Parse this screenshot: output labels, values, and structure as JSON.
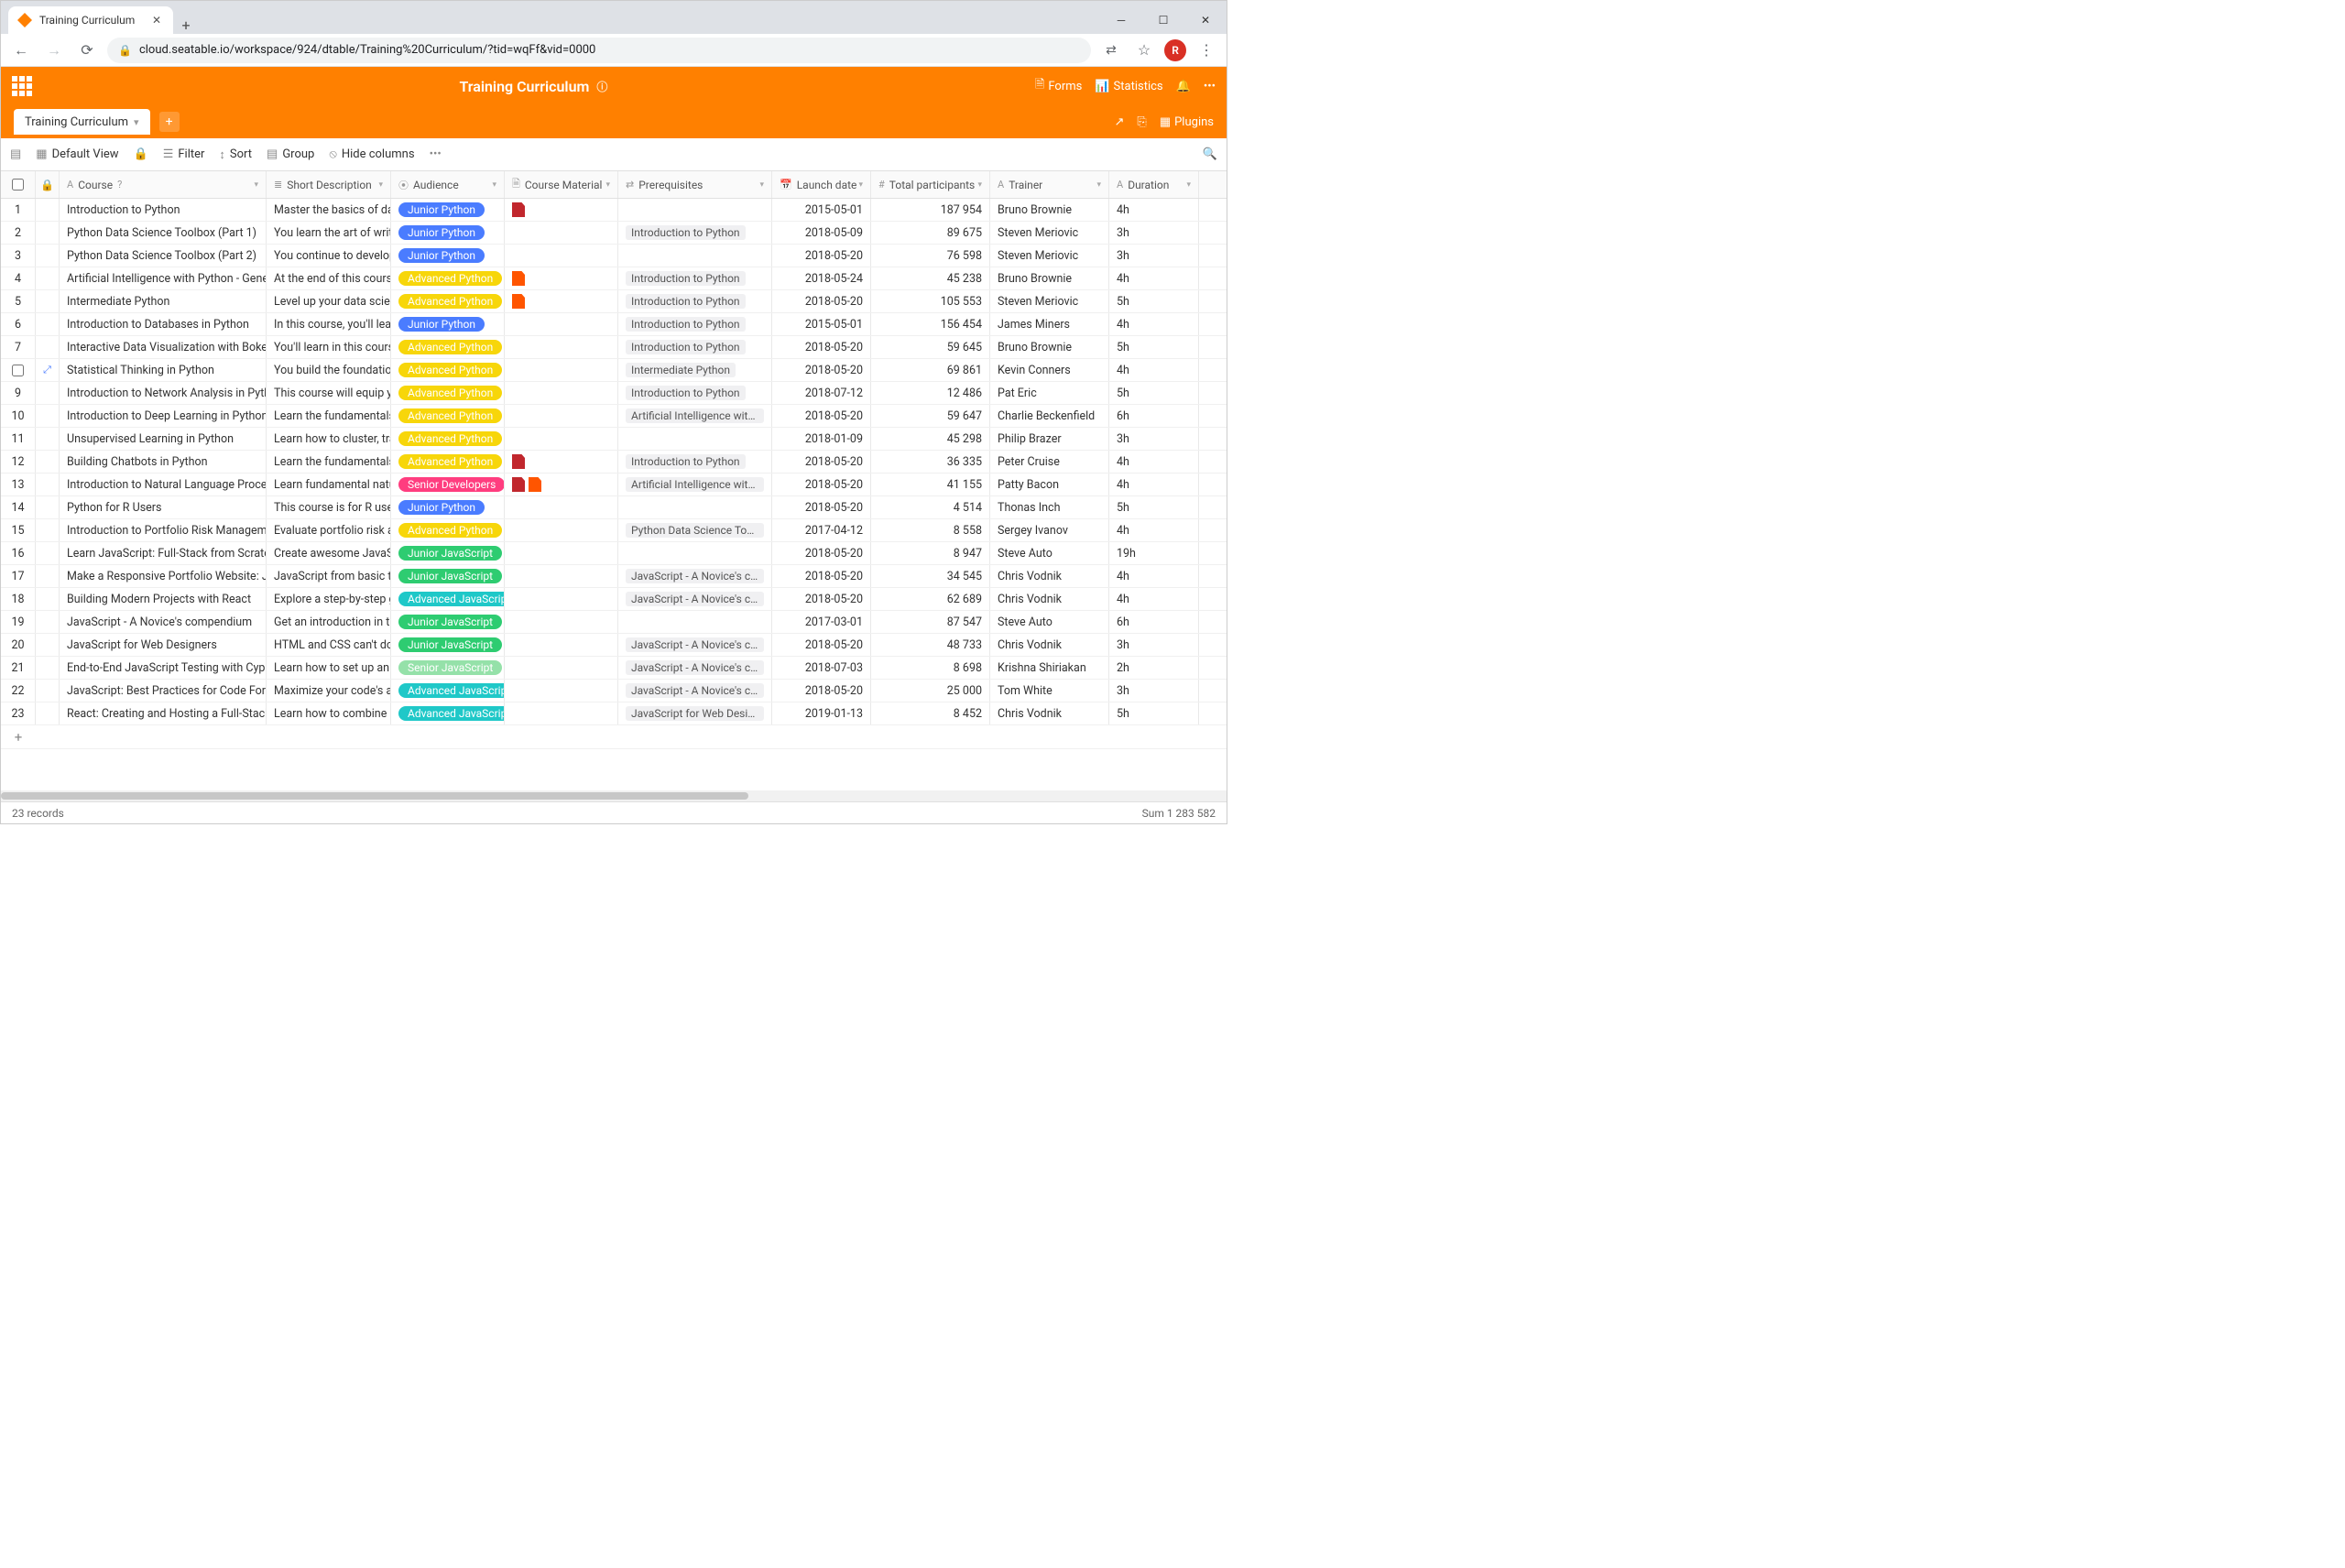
{
  "browser": {
    "tab_title": "Training Curriculum",
    "url_display": "cloud.seatable.io/workspace/924/dtable/Training%20Curriculum/?tid=wqFf&vid=0000",
    "avatar_letter": "R"
  },
  "header": {
    "title": "Training Curriculum",
    "forms": "Forms",
    "statistics": "Statistics",
    "plugins": "Plugins"
  },
  "table_tab": "Training Curriculum",
  "toolbar": {
    "view": "Default View",
    "filter": "Filter",
    "sort": "Sort",
    "group": "Group",
    "hide": "Hide columns"
  },
  "columns": {
    "course": "Course",
    "desc": "Short Description",
    "aud": "Audience",
    "mat": "Course Material",
    "pre": "Prerequisites",
    "date": "Launch date",
    "tot": "Total participants",
    "tr": "Trainer",
    "dur": "Duration"
  },
  "audience_colors": {
    "Junior Python": "#4a7cff",
    "Advanced Python": "#f7d60a",
    "Senior Developers": "#ff3d7f",
    "Junior JavaScript": "#2ecc71",
    "Advanced JavaScript": "#1fc8c8",
    "Senior JavaScript": "#95e1a9"
  },
  "rows": [
    {
      "n": "1",
      "course": "Introduction to Python",
      "desc": "Master the basics of dat...",
      "aud": "Junior Python",
      "mat": [
        "pdf"
      ],
      "pre": "",
      "date": "2015-05-01",
      "tot": "187 954",
      "tr": "Bruno Brownie",
      "dur": "4h"
    },
    {
      "n": "2",
      "course": "Python Data Science Toolbox (Part 1)",
      "desc": "You learn the art of writi...",
      "aud": "Junior Python",
      "mat": [],
      "pre": "Introduction to Python",
      "date": "2018-05-09",
      "tot": "89 675",
      "tr": "Steven Meriovic",
      "dur": "3h"
    },
    {
      "n": "3",
      "course": "Python Data Science Toolbox (Part 2)",
      "desc": "You continue to develop...",
      "aud": "Junior Python",
      "mat": [],
      "pre": "",
      "date": "2018-05-20",
      "tot": "76 598",
      "tr": "Steven Meriovic",
      "dur": "3h"
    },
    {
      "n": "4",
      "course": "Artificial Intelligence with Python - General...",
      "desc": "At the end of this cours...",
      "aud": "Advanced Python",
      "mat": [
        "pdf-o"
      ],
      "pre": "Introduction to Python",
      "date": "2018-05-24",
      "tot": "45 238",
      "tr": "Bruno Brownie",
      "dur": "4h"
    },
    {
      "n": "5",
      "course": "Intermediate Python",
      "desc": "Level up your data scien...",
      "aud": "Advanced Python",
      "mat": [
        "pdf-o"
      ],
      "pre": "Introduction to Python",
      "date": "2018-05-20",
      "tot": "105 553",
      "tr": "Steven Meriovic",
      "dur": "5h"
    },
    {
      "n": "6",
      "course": "Introduction to Databases in Python",
      "desc": "In this course, you'll lear...",
      "aud": "Junior Python",
      "mat": [],
      "pre": "Introduction to Python",
      "date": "2015-05-01",
      "tot": "156 454",
      "tr": "James Miners",
      "dur": "4h"
    },
    {
      "n": "7",
      "course": "Interactive Data Visualization with Bokeh",
      "desc": "You'll learn in this cours...",
      "aud": "Advanced Python",
      "mat": [],
      "pre": "Introduction to Python",
      "date": "2018-05-20",
      "tot": "59 645",
      "tr": "Bruno Brownie",
      "dur": "5h"
    },
    {
      "n": "",
      "course": "Statistical Thinking in Python",
      "desc": "You build the foundatio...",
      "aud": "Advanced Python",
      "mat": [],
      "pre": "Intermediate Python",
      "date": "2018-05-20",
      "tot": "69 861",
      "tr": "Kevin Conners",
      "dur": "4h",
      "hover": true
    },
    {
      "n": "9",
      "course": "Introduction to Network Analysis in Python",
      "desc": "This course will equip yo...",
      "aud": "Advanced Python",
      "mat": [],
      "pre": "Introduction to Python",
      "date": "2018-07-12",
      "tot": "12 486",
      "tr": "Pat Eric",
      "dur": "5h"
    },
    {
      "n": "10",
      "course": "Introduction to Deep Learning in Python",
      "desc": "Learn the fundamentals ...",
      "aud": "Advanced Python",
      "mat": [],
      "pre": "Artificial Intelligence with Python -",
      "date": "2018-05-20",
      "tot": "59 647",
      "tr": "Charlie Beckenfield",
      "dur": "6h"
    },
    {
      "n": "11",
      "course": "Unsupervised Learning in Python",
      "desc": "Learn how to cluster, tra...",
      "aud": "Advanced Python",
      "mat": [],
      "pre": "",
      "date": "2018-01-09",
      "tot": "45 298",
      "tr": "Philip Brazer",
      "dur": "3h"
    },
    {
      "n": "12",
      "course": "Building Chatbots in Python",
      "desc": "Learn the fundamentals ...",
      "aud": "Advanced Python",
      "mat": [
        "pdf"
      ],
      "pre": "Introduction to Python",
      "date": "2018-05-20",
      "tot": "36 335",
      "tr": "Peter Cruise",
      "dur": "4h"
    },
    {
      "n": "13",
      "course": "Introduction to Natural Language Processi...",
      "desc": "Learn fundamental natu...",
      "aud": "Senior Developers",
      "mat": [
        "pdf",
        "pdf-o"
      ],
      "pre": "Artificial Intelligence with Python -",
      "date": "2018-05-20",
      "tot": "41 155",
      "tr": "Patty Bacon",
      "dur": "4h"
    },
    {
      "n": "14",
      "course": "Python for R Users",
      "desc": "This course is for R users...",
      "aud": "Junior Python",
      "mat": [],
      "pre": "",
      "date": "2018-05-20",
      "tot": "4 514",
      "tr": "Thonas Inch",
      "dur": "5h"
    },
    {
      "n": "15",
      "course": "Introduction to Portfolio Risk Management...",
      "desc": "Evaluate portfolio risk a...",
      "aud": "Advanced Python",
      "mat": [],
      "pre": "Python Data Science Toolbox (Part",
      "date": "2017-04-12",
      "tot": "8 558",
      "tr": "Sergey Ivanov",
      "dur": "4h"
    },
    {
      "n": "16",
      "course": "Learn JavaScript: Full-Stack from Scratch",
      "desc": "Create awesome JavaScr...",
      "aud": "Junior JavaScript",
      "mat": [],
      "pre": "",
      "date": "2018-05-20",
      "tot": "8 947",
      "tr": "Steve Auto",
      "dur": "19h"
    },
    {
      "n": "17",
      "course": "Make a Responsive Portfolio Website: Javas...",
      "desc": "JavaScript from basic to ...",
      "aud": "Junior JavaScript",
      "mat": [],
      "pre": "JavaScript - A Novice's compendium",
      "date": "2018-05-20",
      "tot": "34 545",
      "tr": "Chris Vodnik",
      "dur": "4h"
    },
    {
      "n": "18",
      "course": "Building Modern Projects with React",
      "desc": "Explore a step-by-step g...",
      "aud": "Advanced JavaScript",
      "mat": [],
      "pre": "JavaScript - A Novice's compendium",
      "date": "2018-05-20",
      "tot": "62 689",
      "tr": "Chris Vodnik",
      "dur": "4h"
    },
    {
      "n": "19",
      "course": "JavaScript - A Novice's compendium",
      "desc": "Get an introduction in t...",
      "aud": "Junior JavaScript",
      "mat": [],
      "pre": "",
      "date": "2017-03-01",
      "tot": "87 547",
      "tr": "Steve Auto",
      "dur": "6h"
    },
    {
      "n": "20",
      "course": "JavaScript for Web Designers",
      "desc": "HTML and CSS can't do ...",
      "aud": "Junior JavaScript",
      "mat": [],
      "pre": "JavaScript - A Novice's compendium",
      "date": "2018-05-20",
      "tot": "48 733",
      "tr": "Chris Vodnik",
      "dur": "3h"
    },
    {
      "n": "21",
      "course": "End-to-End JavaScript Testing with Cypress...",
      "desc": "Learn how to set up an ...",
      "aud": "Senior JavaScript",
      "mat": [],
      "pre": "JavaScript - A Novice's compendium",
      "date": "2018-07-03",
      "tot": "8 698",
      "tr": "Krishna Shiriakan",
      "dur": "2h"
    },
    {
      "n": "22",
      "course": "JavaScript: Best Practices for Code Formatti...",
      "desc": "Maximize your code's a...",
      "aud": "Advanced JavaScript",
      "mat": [],
      "pre": "JavaScript - A Novice's compendium",
      "date": "2018-05-20",
      "tot": "25 000",
      "tr": "Tom White",
      "dur": "3h"
    },
    {
      "n": "23",
      "course": "React: Creating and Hosting a Full-Stack Site",
      "desc": "Learn how to combine R...",
      "aud": "Advanced JavaScript",
      "mat": [],
      "pre": "JavaScript for Web Designers",
      "date": "2019-01-13",
      "tot": "8 452",
      "tr": "Chris Vodnik",
      "dur": "5h"
    }
  ],
  "footer": {
    "records": "23 records",
    "sum": "Sum 1 283 582"
  }
}
